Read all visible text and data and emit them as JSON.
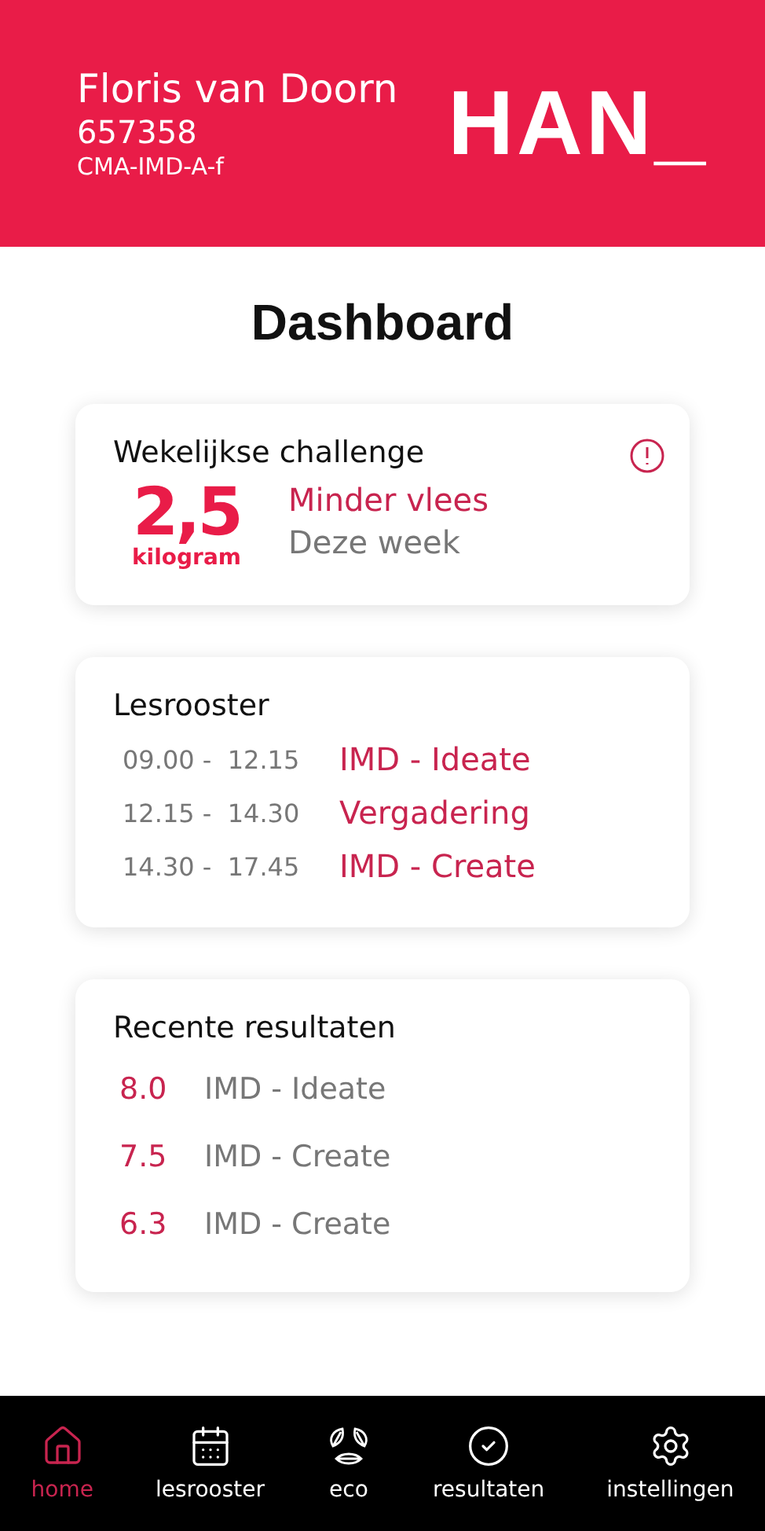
{
  "header": {
    "name": "Floris van Doorn",
    "student_number": "657358",
    "class": "CMA-IMD-A-f",
    "logo": "HAN_"
  },
  "title": "Dashboard",
  "challenge": {
    "title": "Wekelijkse challenge",
    "amount": "2,5",
    "unit": "kilogram",
    "goal": "Minder vlees",
    "period": "Deze week"
  },
  "schedule": {
    "title": "Lesrooster",
    "rows": [
      {
        "time": "09.00 -  12.15",
        "subject": "IMD - Ideate"
      },
      {
        "time": "12.15 -  14.30",
        "subject": "Vergadering"
      },
      {
        "time": "14.30 -  17.45",
        "subject": "IMD - Create"
      }
    ]
  },
  "results": {
    "title": "Recente resultaten",
    "rows": [
      {
        "grade": "8.0",
        "course": "IMD - Ideate"
      },
      {
        "grade": "7.5",
        "course": "IMD - Create"
      },
      {
        "grade": "6.3",
        "course": "IMD - Create"
      }
    ]
  },
  "nav": [
    {
      "kind": "home",
      "label": "home",
      "selected": true
    },
    {
      "kind": "calendar",
      "label": "lesrooster",
      "selected": false
    },
    {
      "kind": "eco",
      "label": "eco",
      "selected": false
    },
    {
      "kind": "check",
      "label": "resultaten",
      "selected": false
    },
    {
      "kind": "settings",
      "label": "instellingen",
      "selected": false
    }
  ]
}
